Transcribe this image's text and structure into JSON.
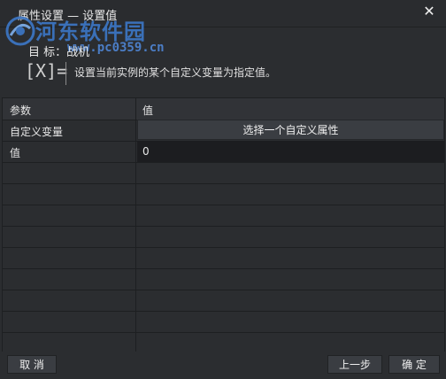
{
  "window": {
    "title": "属性设置 — 设置值",
    "close_icon": "close-icon"
  },
  "watermark": {
    "name": "河东软件园",
    "url": "www.pc0359.cn"
  },
  "target": {
    "label": "目  标：战机"
  },
  "action": {
    "icon": "set-variable-icon",
    "icon_glyph": "[X]=",
    "description": "设置当前实例的某个自定义变量为指定值。"
  },
  "grid": {
    "headers": [
      "参数",
      "值"
    ],
    "rows": [
      {
        "param": "自定义变量",
        "value_button": "选择一个自定义属性"
      },
      {
        "param": "值",
        "value": "0"
      }
    ],
    "empty_rows": 9
  },
  "footer": {
    "cancel_label": "取 消",
    "prev_label": "上一步",
    "ok_label": "确 定"
  }
}
